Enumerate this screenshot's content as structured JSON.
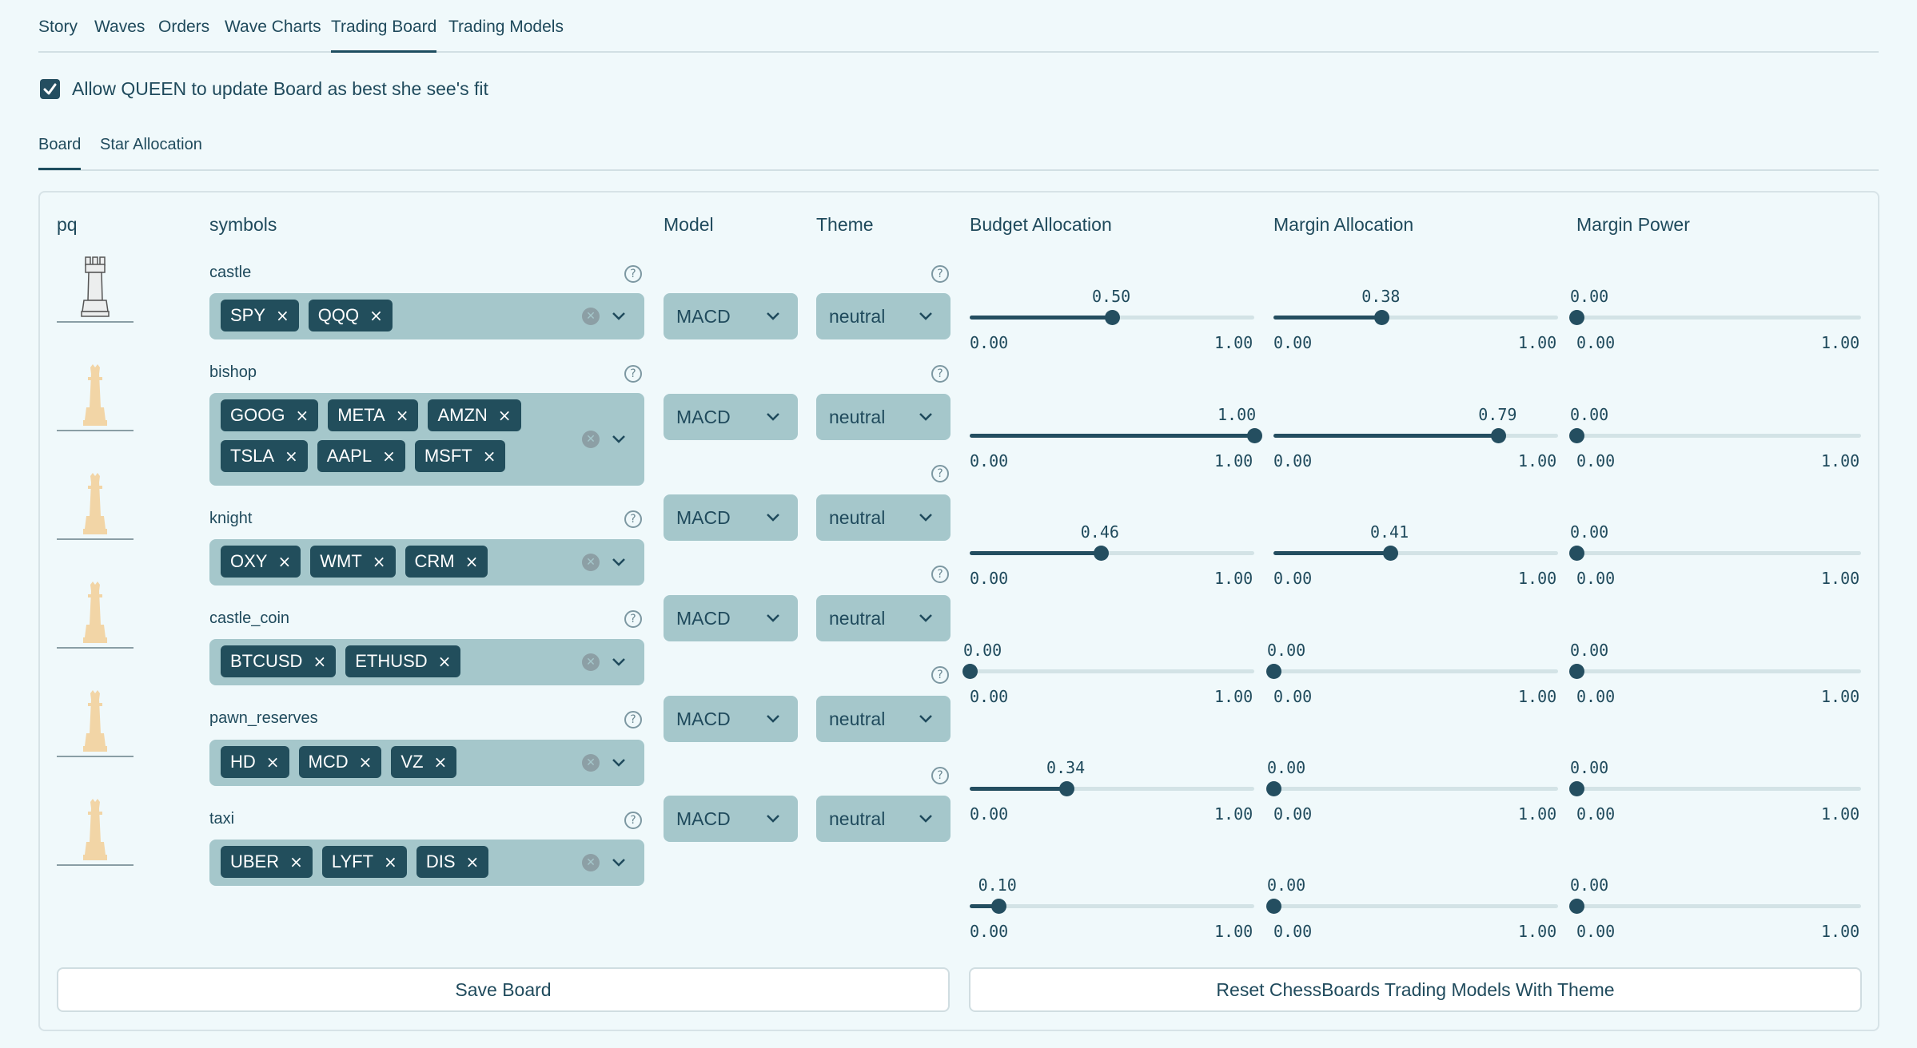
{
  "nav": {
    "tabs": [
      {
        "label": "Story"
      },
      {
        "label": "Waves"
      },
      {
        "label": "Orders"
      },
      {
        "label": "Wave Charts"
      },
      {
        "label": "Trading Board"
      },
      {
        "label": "Trading Models"
      }
    ],
    "active": "Trading Board"
  },
  "queen_update": {
    "checked": true,
    "label": "Allow QUEEN to update Board as best she see's fit"
  },
  "subtabs": {
    "items": [
      {
        "label": "Board"
      },
      {
        "label": "Star Allocation"
      }
    ],
    "active": "Board"
  },
  "columns": {
    "pq": "pq",
    "symbols": "symbols",
    "model": "Model",
    "theme": "Theme",
    "budget": "Budget Allocation",
    "margin_alloc": "Margin Allocation",
    "margin_power": "Margin Power"
  },
  "rows": [
    {
      "piece": "castle",
      "label": "castle",
      "symbols": [
        "SPY",
        "QQQ"
      ],
      "model": "MACD",
      "theme": "neutral"
    },
    {
      "piece": "bishop",
      "label": "bishop",
      "symbols": [
        "GOOG",
        "META",
        "AMZN",
        "TSLA",
        "AAPL",
        "MSFT"
      ],
      "model": "MACD",
      "theme": "neutral"
    },
    {
      "piece": "bishop",
      "label": "knight",
      "symbols": [
        "OXY",
        "WMT",
        "CRM"
      ],
      "model": "MACD",
      "theme": "neutral"
    },
    {
      "piece": "bishop",
      "label": "castle_coin",
      "symbols": [
        "BTCUSD",
        "ETHUSD"
      ],
      "model": "MACD",
      "theme": "neutral"
    },
    {
      "piece": "bishop",
      "label": "pawn_reserves",
      "symbols": [
        "HD",
        "MCD",
        "VZ"
      ],
      "model": "MACD",
      "theme": "neutral"
    },
    {
      "piece": "bishop",
      "label": "taxi",
      "symbols": [
        "UBER",
        "LYFT",
        "DIS"
      ],
      "model": "MACD",
      "theme": "neutral"
    }
  ],
  "sliders": {
    "min_label": "0.00",
    "max_label": "1.00",
    "rows": [
      {
        "budget": "0.50",
        "margin_alloc": "0.38",
        "margin_power": "0.00"
      },
      {
        "budget": "1.00",
        "margin_alloc": "0.79",
        "margin_power": "0.00"
      },
      {
        "budget": "0.46",
        "margin_alloc": "0.41",
        "margin_power": "0.00"
      },
      {
        "budget": "0.00",
        "margin_alloc": "0.00",
        "margin_power": "0.00"
      },
      {
        "budget": "0.34",
        "margin_alloc": "0.00",
        "margin_power": "0.00"
      },
      {
        "budget": "0.10",
        "margin_alloc": "0.00",
        "margin_power": "0.00"
      }
    ]
  },
  "buttons": {
    "save": "Save Board",
    "reset": "Reset ChessBoards Trading Models With Theme"
  },
  "colors": {
    "accent": "#244e60",
    "chip_bg": "#224e5c",
    "input_bg": "#a5c7cb",
    "page_bg": "#f0f9fb",
    "piece_cream": "#f2d5a6"
  }
}
